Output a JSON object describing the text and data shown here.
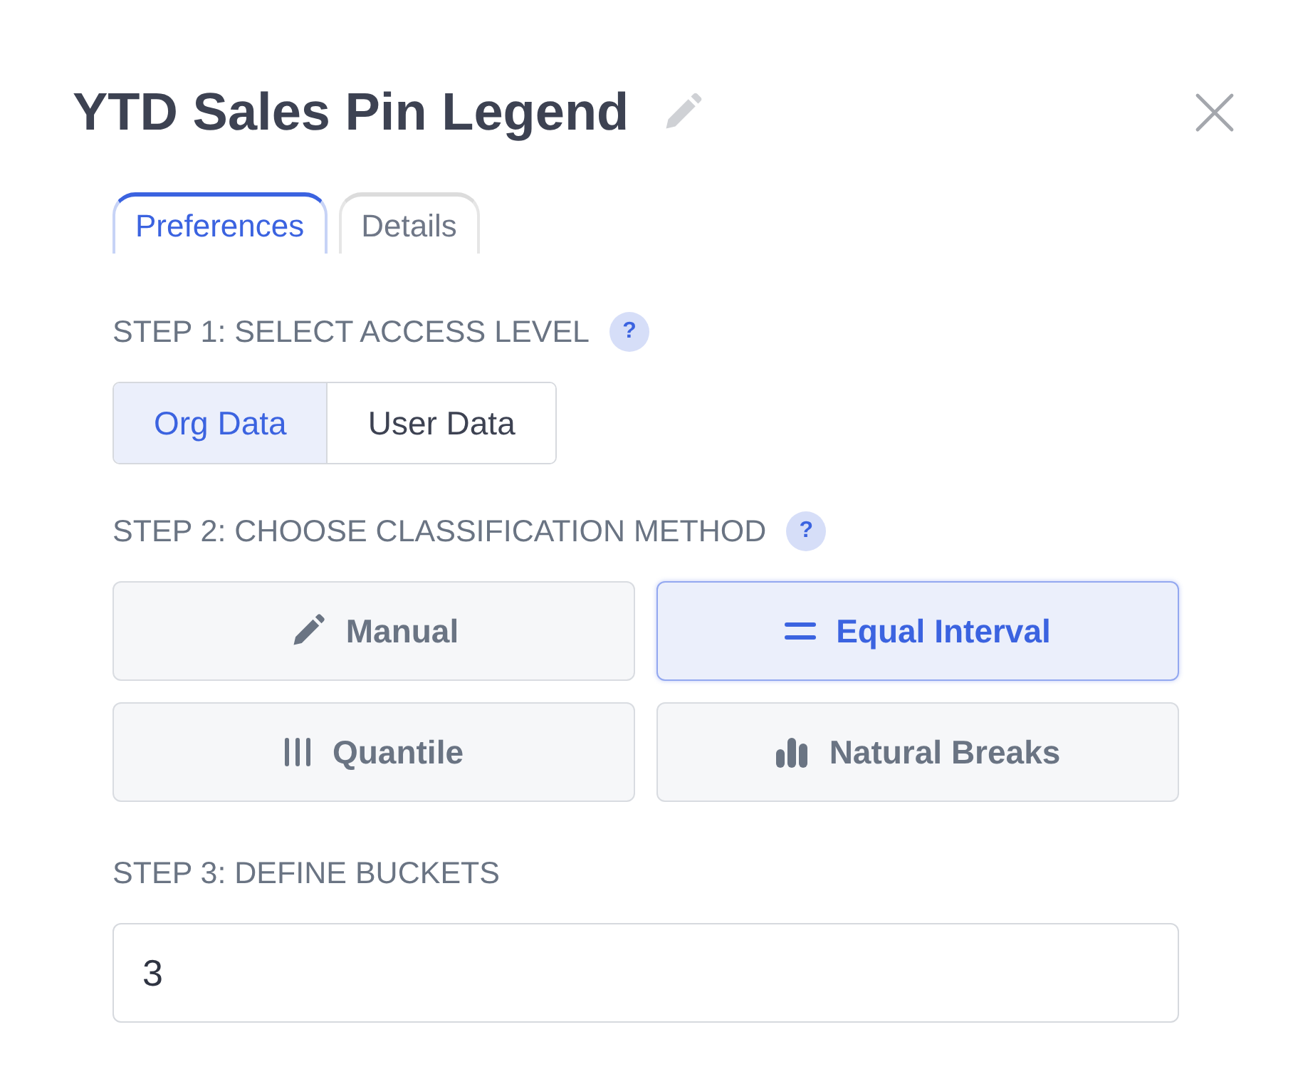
{
  "dialog": {
    "title": "YTD Sales Pin Legend"
  },
  "tabs": [
    {
      "label": "Preferences",
      "selected": true
    },
    {
      "label": "Details",
      "selected": false
    }
  ],
  "step_1": {
    "label": "STEP 1: SELECT ACCESS LEVEL",
    "help": "?",
    "options": [
      {
        "label": "Org Data",
        "selected": true
      },
      {
        "label": "User Data",
        "selected": false
      }
    ]
  },
  "step_2": {
    "label": "STEP 2: CHOOSE CLASSIFICATION METHOD",
    "help": "?",
    "methods": [
      {
        "label": "Manual",
        "kind": "pencil",
        "selected": false
      },
      {
        "label": "Equal Interval",
        "kind": "equals",
        "selected": true
      },
      {
        "label": "Quantile",
        "kind": "bars",
        "selected": false
      },
      {
        "label": "Natural Breaks",
        "kind": "chart",
        "selected": false
      }
    ]
  },
  "step_3": {
    "label": "STEP 3: DEFINE BUCKETS",
    "value": "3"
  }
}
